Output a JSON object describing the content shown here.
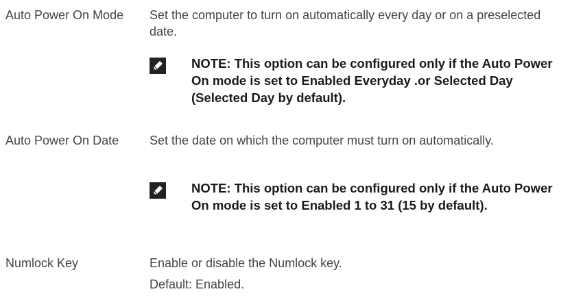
{
  "settings": [
    {
      "label": "Auto Power On Mode",
      "description": "Set the computer to turn on automatically every day or on a preselected date.",
      "note": "NOTE: This option can be configured only if the Auto Power On mode is set to Enabled Everyday .or Selected Day (Selected Day by default).",
      "note_icon": "note-pencil-icon"
    },
    {
      "label": "Auto Power On Date",
      "description": "Set the date on which the computer must turn on automatically.",
      "note": "NOTE: This option can be configured only if the Auto Power On mode is set to Enabled 1 to 31 (15 by default).",
      "note_icon": "note-pencil-icon"
    },
    {
      "label": "Numlock Key",
      "description": "Enable or disable the Numlock key.",
      "default_text": "Default: Enabled."
    }
  ]
}
